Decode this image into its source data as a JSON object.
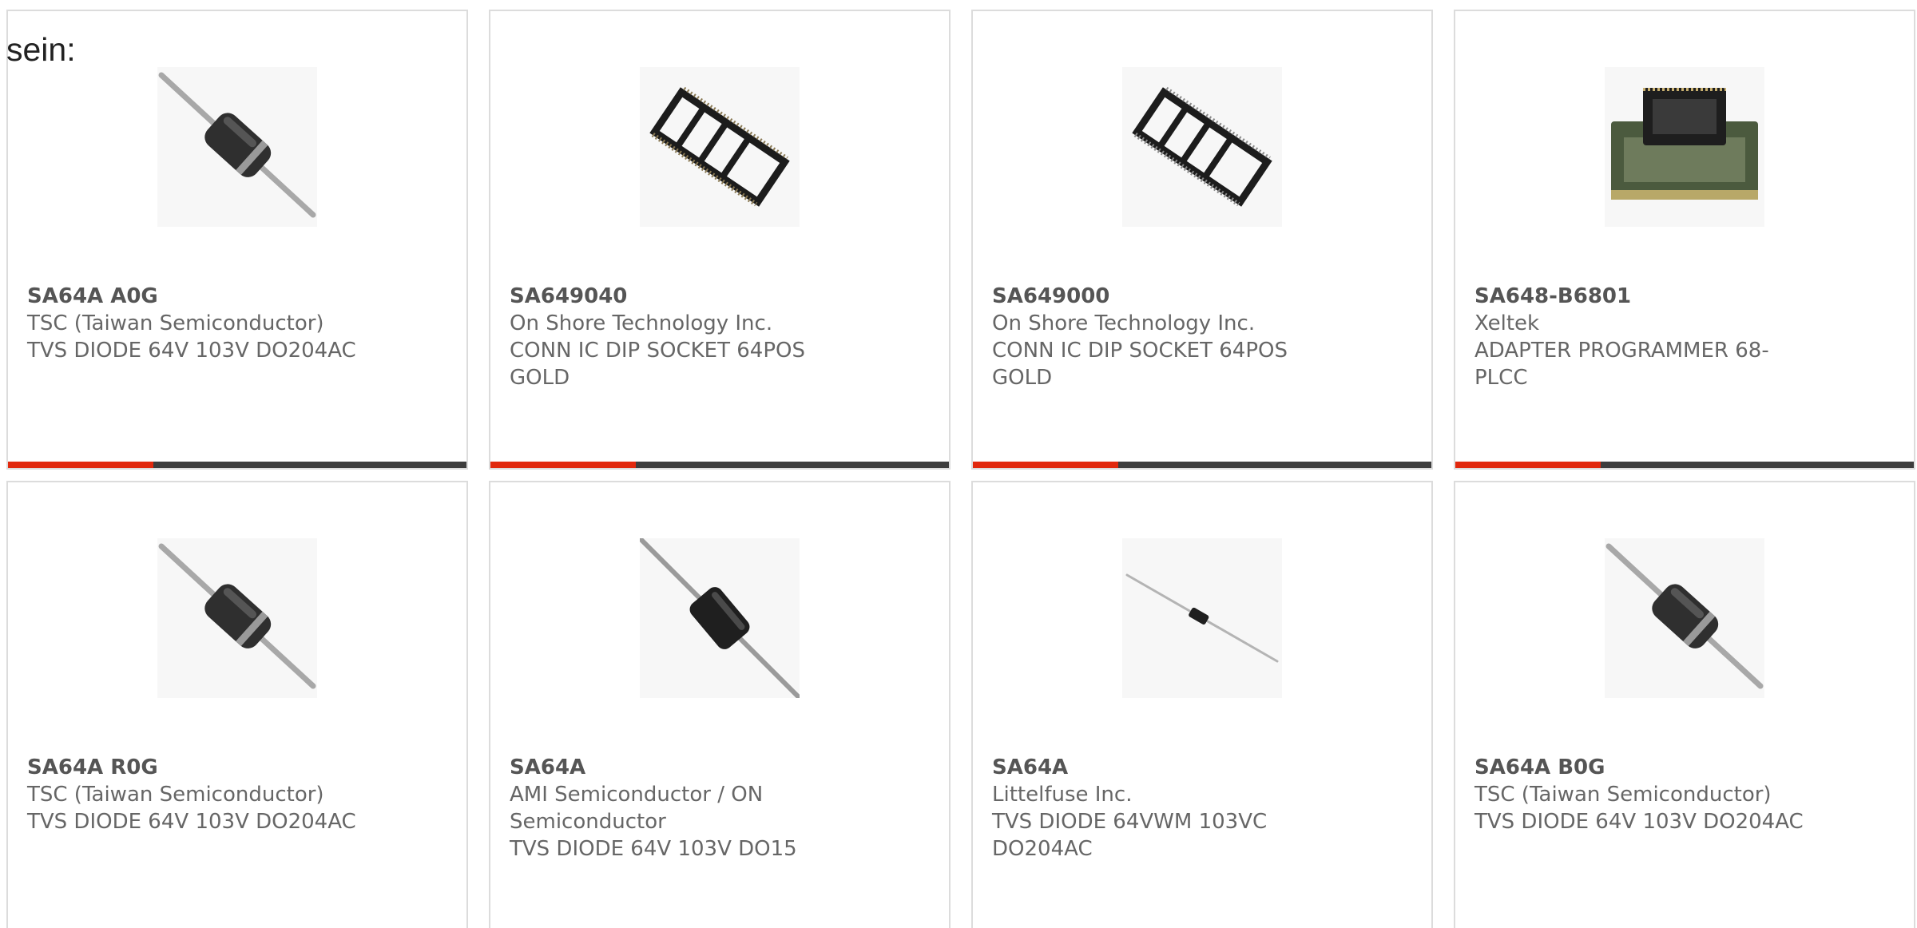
{
  "intro": {
    "text": "sein:"
  },
  "products": [
    {
      "part_number": "SA64A A0G",
      "manufacturer": "TSC (Taiwan Semiconductor)",
      "description": "TVS DIODE 64V 103V DO204AC",
      "image_icon": "axial-diode-icon"
    },
    {
      "part_number": "SA649040",
      "manufacturer": "On Shore Technology Inc.",
      "description": "CONN IC DIP SOCKET 64POS GOLD",
      "image_icon": "dip-socket-icon"
    },
    {
      "part_number": "SA649000",
      "manufacturer": "On Shore Technology Inc.",
      "description": "CONN IC DIP SOCKET 64POS GOLD",
      "image_icon": "dip-socket-icon"
    },
    {
      "part_number": "SA648-B6801",
      "manufacturer": "Xeltek",
      "description": "ADAPTER PROGRAMMER 68-PLCC",
      "image_icon": "programmer-adapter-icon"
    },
    {
      "part_number": "SA64A R0G",
      "manufacturer": "TSC (Taiwan Semiconductor)",
      "description": "TVS DIODE 64V 103V DO204AC",
      "image_icon": "axial-diode-icon"
    },
    {
      "part_number": "SA64A",
      "manufacturer": "AMI Semiconductor / ON Semiconductor",
      "description": "TVS DIODE 64V 103V DO15",
      "image_icon": "axial-diode-icon"
    },
    {
      "part_number": "SA64A",
      "manufacturer": "Littelfuse Inc.",
      "description": "TVS DIODE 64VWM 103VC DO204AC",
      "image_icon": "axial-diode-icon"
    },
    {
      "part_number": "SA64A B0G",
      "manufacturer": "TSC (Taiwan Semiconductor)",
      "description": "TVS DIODE 64V 103V DO204AC",
      "image_icon": "axial-diode-icon"
    }
  ],
  "colors": {
    "accent": "#e1290e",
    "bar": "#3d3d3d",
    "border": "#dcdcdc",
    "text": "#666666"
  }
}
